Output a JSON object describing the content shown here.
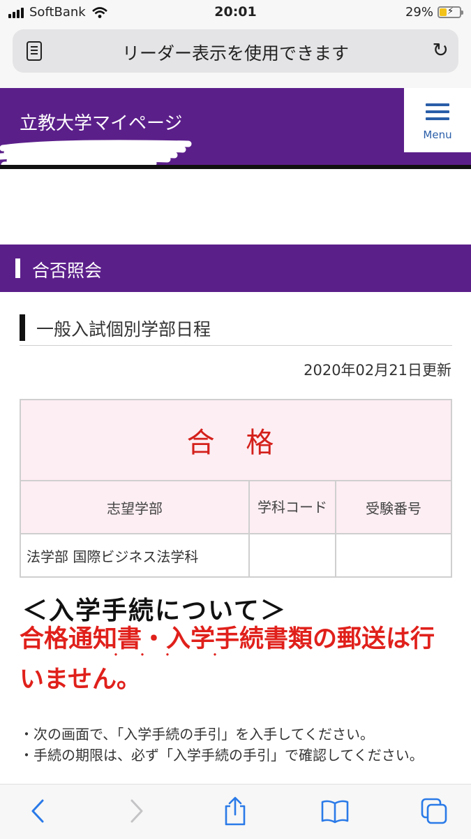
{
  "status": {
    "carrier": "SoftBank",
    "time": "20:01",
    "battery": "29%"
  },
  "url_bar": {
    "text": "リーダー表示を使用できます"
  },
  "header": {
    "title": "立教大学マイページ",
    "menu_label": "Menu"
  },
  "section": {
    "title": "合否照会"
  },
  "subsection": {
    "title": "一般入試個別学部日程",
    "updated": "2020年02月21日更新"
  },
  "result": {
    "status": "合 格",
    "columns": [
      "志望学部",
      "学科コード",
      "受験番号"
    ],
    "row": [
      "法学部 国際ビジネス法学科",
      "",
      ""
    ]
  },
  "procedure": {
    "title": "＜入学手続について＞",
    "notice": "合格通知書・入学手続書類の郵送は行いません。",
    "bullets": [
      "・次の画面で、「入学手続の手引」を入手してください。",
      "・手続の期限は、必ず「入学手続の手引」で確認してください。"
    ]
  },
  "colors": {
    "brand_purple": "#5b1f8a",
    "pass_red": "#d4201b",
    "pink_bg": "#fdeef3",
    "ios_blue": "#2a7ae8"
  },
  "toolbar": {
    "icons": [
      "back-icon",
      "forward-icon",
      "share-icon",
      "bookmarks-icon",
      "tabs-icon"
    ]
  }
}
